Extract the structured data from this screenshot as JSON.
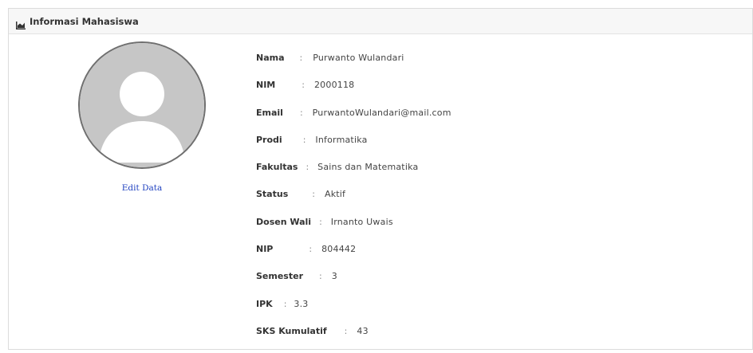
{
  "panel": {
    "title": "Informasi Mahasiswa",
    "header_icon": "chart-icon"
  },
  "profile": {
    "avatar_icon": "default-user-avatar",
    "edit_link": "Edit Data"
  },
  "info": [
    {
      "label": "Nama",
      "separator": ":",
      "value": "Purwanto Wulandari"
    },
    {
      "label": "NIM",
      "separator": ":",
      "value": "2000118"
    },
    {
      "label": "Email",
      "separator": ":",
      "value": "PurwantoWulandari@mail.com"
    },
    {
      "label": "Prodi",
      "separator": ":",
      "value": "Informatika"
    },
    {
      "label": "Fakultas",
      "separator": ":",
      "value": "Sains dan Matematika"
    },
    {
      "label": "Status",
      "separator": ":",
      "value": "Aktif"
    },
    {
      "label": "Dosen Wali",
      "separator": ":",
      "value": "Irnanto Uwais"
    },
    {
      "label": "NIP",
      "separator": ":",
      "value": "804442"
    },
    {
      "label": "Semester",
      "separator": ":",
      "value": "3"
    },
    {
      "label": "IPK",
      "separator": ":",
      "value": "3.3"
    },
    {
      "label": "SKS Kumulatif",
      "separator": ":",
      "value": "43"
    }
  ]
}
